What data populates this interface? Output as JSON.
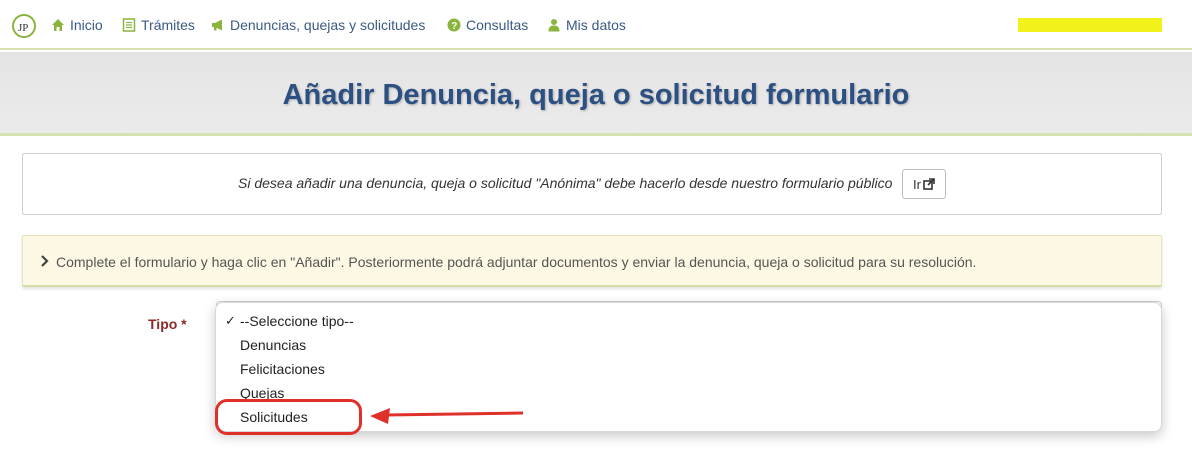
{
  "nav": {
    "logo_text": "JP",
    "items": [
      {
        "label": "Inicio",
        "icon": "home-icon"
      },
      {
        "label": "Trámites",
        "icon": "list-icon"
      },
      {
        "label": "Denuncias, quejas y solicitudes",
        "icon": "megaphone-icon"
      },
      {
        "label": "Consultas",
        "icon": "question-circle-icon"
      },
      {
        "label": "Mis datos",
        "icon": "user-icon"
      }
    ]
  },
  "header": {
    "title": "Añadir Denuncia, queja o solicitud formulario"
  },
  "anon_panel": {
    "text": "Si desea añadir una denuncia, queja o solicitud \"Anónima\" debe hacerlo desde nuestro formulario público",
    "button_label": "Ir"
  },
  "info": {
    "text": "Complete el formulario y haga clic en \"Añadir\". Posteriormente podrá adjuntar documentos y enviar la denuncia, queja o solicitud para su resolución."
  },
  "form": {
    "tipo_label": "Tipo *",
    "tipo_options": [
      "--Seleccione tipo--",
      "Denuncias",
      "Felicitaciones",
      "Quejas",
      "Solicitudes"
    ],
    "selected_index": 0,
    "highlighted_option": "Solicitudes"
  },
  "colors": {
    "nav_link": "#3a5a85",
    "icon_green": "#8ab43c",
    "title_blue": "#2d5083",
    "annotation_red": "#e0302a",
    "info_bg": "#fcf8e3"
  }
}
